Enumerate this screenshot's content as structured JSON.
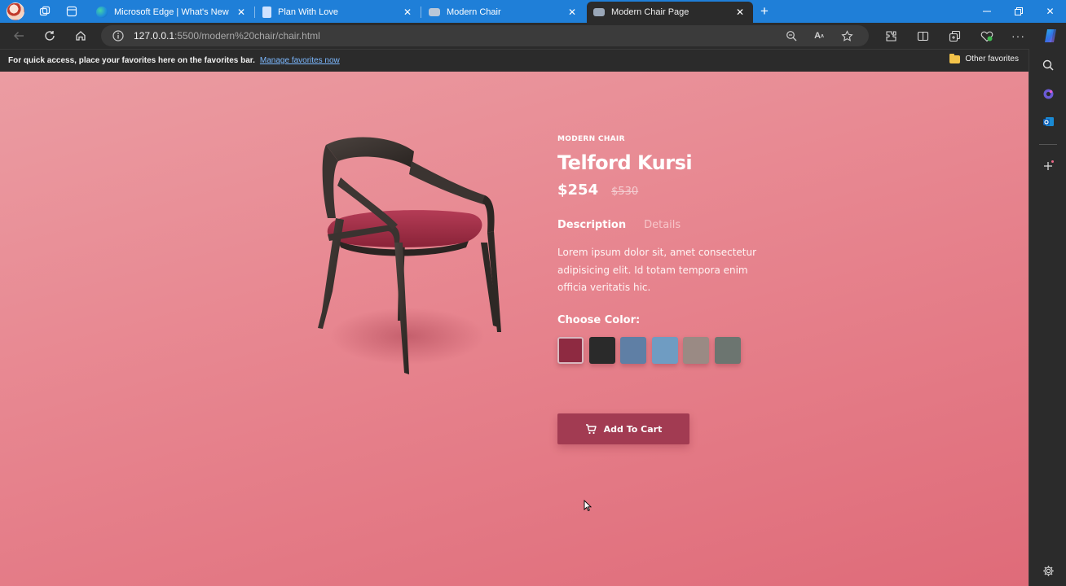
{
  "browser": {
    "tabs": [
      {
        "title": "Microsoft Edge | What's New",
        "active": false
      },
      {
        "title": "Plan With Love",
        "active": false
      },
      {
        "title": "Modern Chair",
        "active": false
      },
      {
        "title": "Modern Chair Page",
        "active": true
      }
    ],
    "url_host": "127.0.0.1",
    "url_path": ":5500/modern%20chair/chair.html",
    "favorites_message": "For quick access, place your favorites here on the favorites bar.",
    "favorites_link": "Manage favorites now",
    "other_favorites": "Other favorites"
  },
  "product": {
    "category": "MODERN CHAIR",
    "name": "Telford Kursi",
    "price": "$254",
    "old_price": "$530",
    "tab_description": "Description",
    "tab_details": "Details",
    "description": "Lorem ipsum dolor sit, amet consectetur adipisicing elit. Id totam tempora enim officia veritatis hic.",
    "choose_color": "Choose Color:",
    "colors": [
      "#8e2a41",
      "#2a2a2a",
      "#5f7fa5",
      "#6f9cc2",
      "#9a8a84",
      "#6c7570"
    ],
    "add_to_cart": "Add To Cart"
  }
}
